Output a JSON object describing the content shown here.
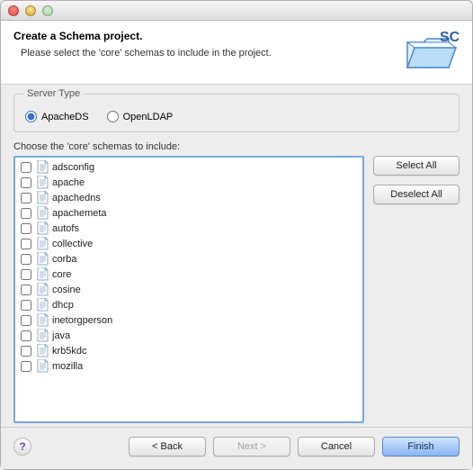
{
  "banner": {
    "title": "Create a Schema project.",
    "subtitle": "Please select the 'core' schemas to include in the project.",
    "icon_label": "SC"
  },
  "server_type": {
    "group_label": "Server Type",
    "options": {
      "apacheds": "ApacheDS",
      "openldap": "OpenLDAP"
    },
    "selected": "apacheds"
  },
  "schemas": {
    "label": "Choose the 'core' schemas to include:",
    "items": [
      "adsconfig",
      "apache",
      "apachedns",
      "apachemeta",
      "autofs",
      "collective",
      "corba",
      "core",
      "cosine",
      "dhcp",
      "inetorgperson",
      "java",
      "krb5kdc",
      "mozilla"
    ]
  },
  "buttons": {
    "select_all": "Select All",
    "deselect_all": "Deselect All",
    "back": "< Back",
    "next": "Next >",
    "cancel": "Cancel",
    "finish": "Finish",
    "help": "?"
  }
}
